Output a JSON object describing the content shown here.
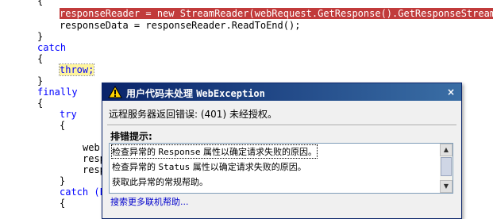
{
  "code": {
    "line1": "{",
    "line2_rest": "responseReader = new StreamReader(webRequest.GetResponse().GetResponseStream()",
    "line3": "responseData = responseReader.ReadToEnd();",
    "line4": "}",
    "line5": "catch",
    "line6": "{",
    "line7": "throw;",
    "line8": "}",
    "line9": "finally",
    "line10": "{",
    "line11": "try",
    "line12": "{",
    "line13": "web",
    "line14": "resp",
    "line15": "resp",
    "line16": "}",
    "line17": "catch (E",
    "line18": "{"
  },
  "dialog": {
    "title_prefix": "用户代码未处理 ",
    "title_exception": "WebException",
    "close_symbol": "×",
    "message": "远程服务器返回错误: (401) 未经授权。",
    "hints_header": "排错提示:",
    "hints": [
      {
        "pre": "检查异常的 ",
        "mono": "Response",
        "post": " 属性以确定请求失败的原因。"
      },
      {
        "pre": "检查异常的 ",
        "mono": "Status",
        "post": " 属性以确定请求失败的原因。"
      },
      {
        "pre": "获取此异常的常规帮助。",
        "mono": "",
        "post": ""
      }
    ],
    "footer_link": "搜索更多联机帮助..."
  }
}
